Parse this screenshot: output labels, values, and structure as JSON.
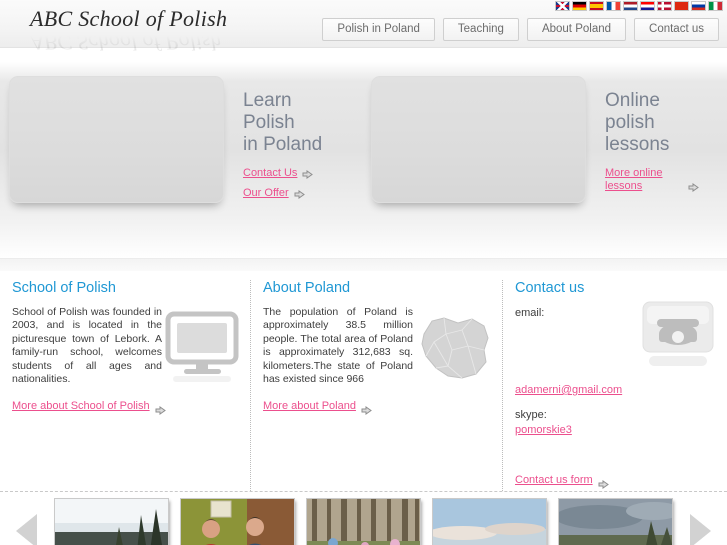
{
  "header": {
    "logo": "ABC School of Polish",
    "nav": [
      {
        "label": "Polish in Poland"
      },
      {
        "label": "Teaching"
      },
      {
        "label": "About Poland"
      },
      {
        "label": "Contact us"
      }
    ],
    "languages": [
      {
        "name": "english-flag",
        "code": "UK"
      },
      {
        "name": "german-flag",
        "code": "DE"
      },
      {
        "name": "spanish-flag",
        "code": "ES"
      },
      {
        "name": "french-flag",
        "code": "FR"
      },
      {
        "name": "dutch-flag",
        "code": "NL"
      },
      {
        "name": "croatian-flag",
        "code": "HR"
      },
      {
        "name": "norwegian-flag",
        "code": "NO"
      },
      {
        "name": "chinese-flag",
        "code": "CN"
      },
      {
        "name": "russian-flag",
        "code": "RU"
      },
      {
        "name": "italian-flag",
        "code": "IT"
      }
    ]
  },
  "hero": {
    "panel_left": {
      "title": "Learn\nPolish\nin Poland",
      "line1": "Learn",
      "line2": "Polish",
      "line3": "in Poland",
      "links": [
        {
          "label": "Contact Us"
        },
        {
          "label": "Our Offer"
        }
      ]
    },
    "panel_right": {
      "line1": "Online",
      "line2": "polish",
      "line3": "lessons",
      "links": [
        {
          "label": "More online lessons"
        }
      ]
    }
  },
  "columns": {
    "school": {
      "title": "School of Polish",
      "body": "School of Polish was founded in 2003, and is located in the picturesque town of Lebork. A family-run school, welcomes students of all ages and nationalities.",
      "more_label": "More about School of Polish",
      "illustration": "monitor-icon"
    },
    "poland": {
      "title": "About Poland",
      "body": "The population of Poland is approximately 38.5 million people. The total area of Poland is approximately 312,683 sq. kilometers.The state of Poland has existed since 966",
      "more_label": "More about Poland",
      "illustration": "poland-map-icon"
    },
    "contact": {
      "title": "Contact us",
      "email_label": "email:",
      "email_value": "adamerni@gmail.com",
      "skype_label": "skype:",
      "skype_value": "pomorskie3",
      "more_label": "Contact us form",
      "illustration": "telephone-icon"
    }
  },
  "gallery": {
    "prev_label": "previous",
    "next_label": "next",
    "thumbs": [
      {
        "name": "thumb-landscape-trees"
      },
      {
        "name": "thumb-two-men-indoors"
      },
      {
        "name": "thumb-forest-people"
      },
      {
        "name": "thumb-sky-clouds"
      },
      {
        "name": "thumb-dark-sky-trees"
      }
    ]
  },
  "colors": {
    "accent_blue": "#2098d4",
    "accent_pink": "#ec4f8d",
    "hero_text": "#7b8391",
    "body_text": "#3d3d3d"
  }
}
